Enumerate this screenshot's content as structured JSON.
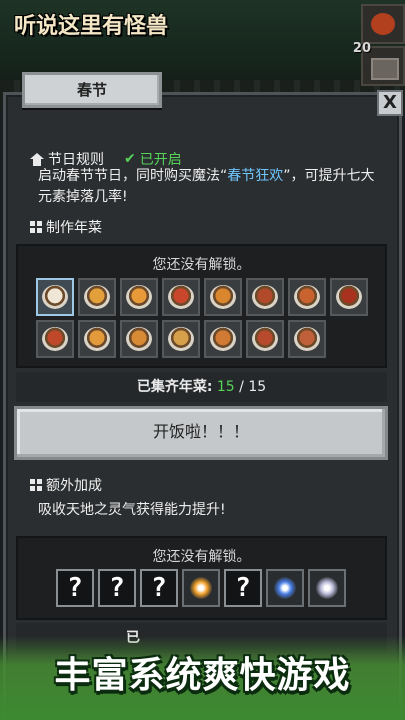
{
  "game_title": "听说这里有怪兽",
  "top_count": "20",
  "tab_title": "春节",
  "close_label": "X",
  "rules": {
    "heading": "节日规则",
    "status": "已开启",
    "desc_before": "启动春节节日，同时购买魔法“",
    "desc_highlight": "春节狂欢",
    "desc_after": "”，可提升七大元素掉落几率!"
  },
  "dishes_section": {
    "heading": "制作年菜",
    "locked_text": "您还没有解锁。",
    "dish_colors": [
      "#efe6d6",
      "#e3a03a",
      "#e89a38",
      "#c9462c",
      "#d9862e",
      "#b04a2a",
      "#c8622f",
      "#a8321d",
      "#c0482a",
      "#e39a3a",
      "#d98a34",
      "#d6a04a",
      "#d07a34",
      "#b74a2c",
      "#c0603a",
      "#c48a3a"
    ],
    "collected_label": "已集齐年菜:",
    "collected_current": "15",
    "collected_sep": " / ",
    "collected_total": "15",
    "button_label": "开饭啦！！！"
  },
  "bonus_section": {
    "heading": "额外加成",
    "desc": "吸收天地之灵气获得能力提升!",
    "locked_text": "您还没有解锁。",
    "slots": [
      {
        "kind": "unknown",
        "label": "?"
      },
      {
        "kind": "unknown",
        "label": "?"
      },
      {
        "kind": "unknown",
        "label": "?"
      },
      {
        "kind": "orb",
        "icon": "fire-orb-icon",
        "color": "#f0a02a"
      },
      {
        "kind": "unknown",
        "label": "?"
      },
      {
        "kind": "orb",
        "icon": "water-orb-icon",
        "color": "#4a7fe6"
      },
      {
        "kind": "orb",
        "icon": "light-orb-icon",
        "color": "#b9b9d8"
      }
    ],
    "cut_label": "已"
  },
  "promo_banner": "丰富系统爽快游戏"
}
